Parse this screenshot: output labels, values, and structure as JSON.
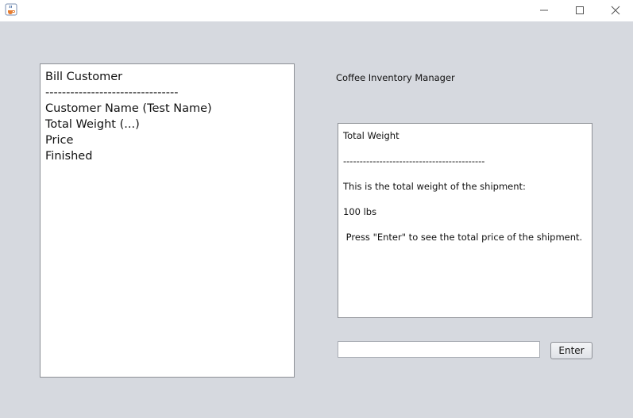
{
  "window": {
    "app_icon": "java-coffee-cup-icon",
    "controls": [
      "minimize-icon",
      "maximize-icon",
      "close-icon"
    ]
  },
  "left_panel": {
    "lines": [
      "Bill Customer",
      "--------------------------------",
      "Customer Name (Test Name)",
      "Total Weight (...)",
      "Price",
      "Finished"
    ]
  },
  "header": {
    "title": "Coffee Inventory Manager"
  },
  "output_panel": {
    "lines": [
      "Total Weight",
      "-------------------------------------------",
      "This is the total weight of the shipment:",
      "100 lbs",
      " Press \"Enter\" to see the total price of the shipment."
    ]
  },
  "input": {
    "value": "",
    "placeholder": ""
  },
  "enter_button": {
    "label": "Enter"
  }
}
